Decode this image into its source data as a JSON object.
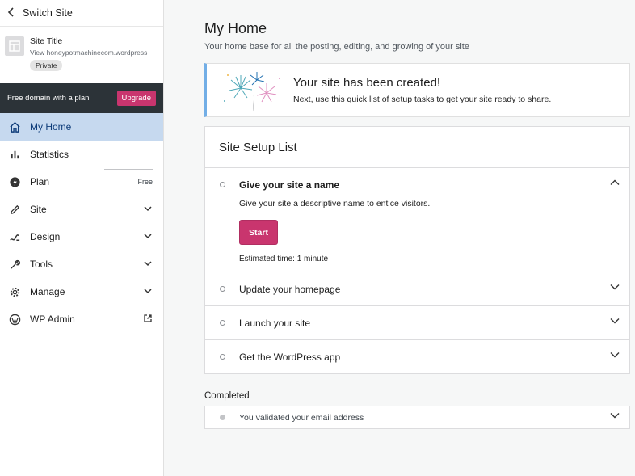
{
  "sidebar": {
    "switch_site": "Switch Site",
    "site": {
      "title": "Site Title",
      "url": "View honeypotmachinecom.wordpress.com",
      "badge": "Private"
    },
    "upgrade": {
      "text": "Free domain with a plan",
      "button": "Upgrade"
    },
    "items": [
      {
        "label": "My Home",
        "icon": "home-icon"
      },
      {
        "label": "Statistics",
        "icon": "stats-icon"
      },
      {
        "label": "Plan",
        "icon": "plan-icon",
        "right": "Free"
      },
      {
        "label": "Site",
        "icon": "pencil-icon"
      },
      {
        "label": "Design",
        "icon": "design-icon"
      },
      {
        "label": "Tools",
        "icon": "wrench-icon"
      },
      {
        "label": "Manage",
        "icon": "gear-icon"
      },
      {
        "label": "WP Admin",
        "icon": "wordpress-icon"
      }
    ]
  },
  "main": {
    "title": "My Home",
    "subtitle": "Your home base for all the posting, editing, and growing of your site",
    "banner": {
      "title": "Your site has been created!",
      "desc": "Next, use this quick list of setup tasks to get your site ready to share."
    },
    "setup": {
      "title": "Site Setup List",
      "tasks": [
        {
          "title": "Give your site a name",
          "desc": "Give your site a descriptive name to entice visitors.",
          "button": "Start",
          "time": "Estimated time: 1 minute"
        },
        {
          "title": "Update your homepage"
        },
        {
          "title": "Launch your site"
        },
        {
          "title": "Get the WordPress app"
        }
      ]
    },
    "completed": {
      "label": "Completed",
      "item": "You validated your email address"
    }
  },
  "colors": {
    "accent": "#c9356e",
    "active_nav": "#c6d9ef",
    "banner_border": "#72aee6",
    "dark_bar": "#2c3338"
  }
}
